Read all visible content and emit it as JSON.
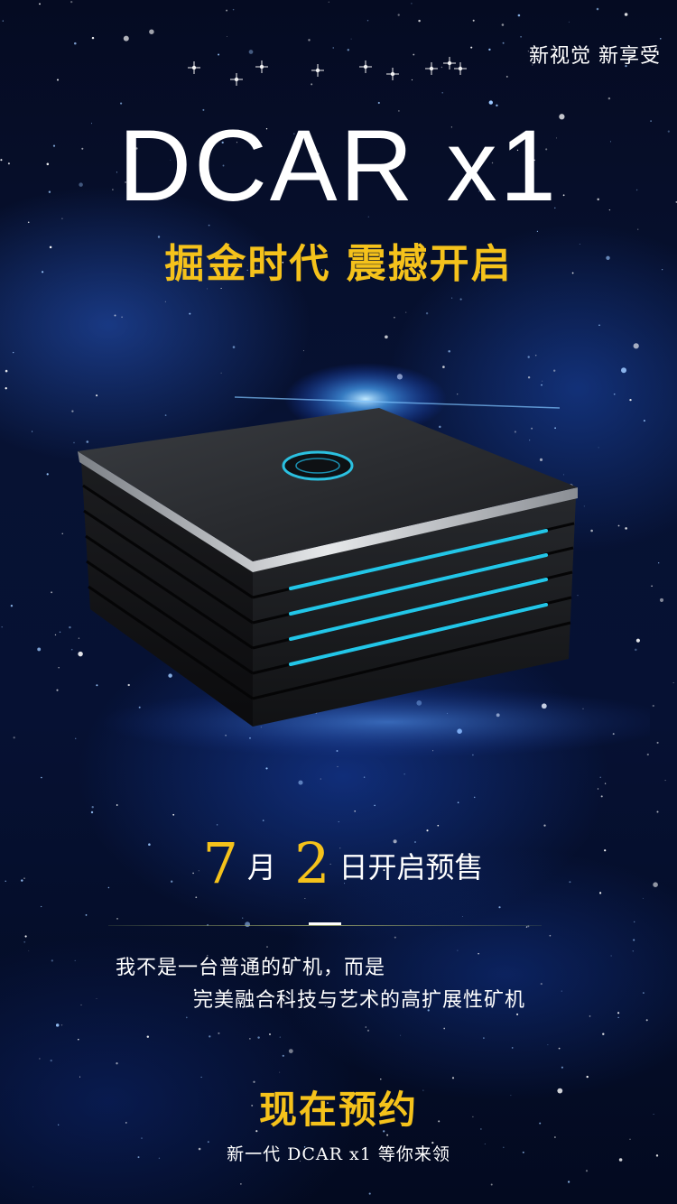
{
  "header": {
    "tagline": "新视觉 新享受",
    "title": "DCAR x1",
    "subtitle": "掘金时代 震撼开启"
  },
  "presale": {
    "month_number": "7",
    "month_unit": "月",
    "day_number": "2",
    "day_suffix": "日开启预售"
  },
  "description": {
    "line1": "我不是一台普通的矿机，而是",
    "line2": "完美融合科技与艺术的高扩展性矿机"
  },
  "cta": {
    "label": "现在预约",
    "sub": "新一代 DCAR x1 等你来领"
  },
  "colors": {
    "accent_gold": "#f5c21b",
    "text_white": "#ffffff",
    "background_navy": "#071233",
    "device_light_cyan": "#22c6e8"
  },
  "icons": [
    "device-logo-icon"
  ]
}
